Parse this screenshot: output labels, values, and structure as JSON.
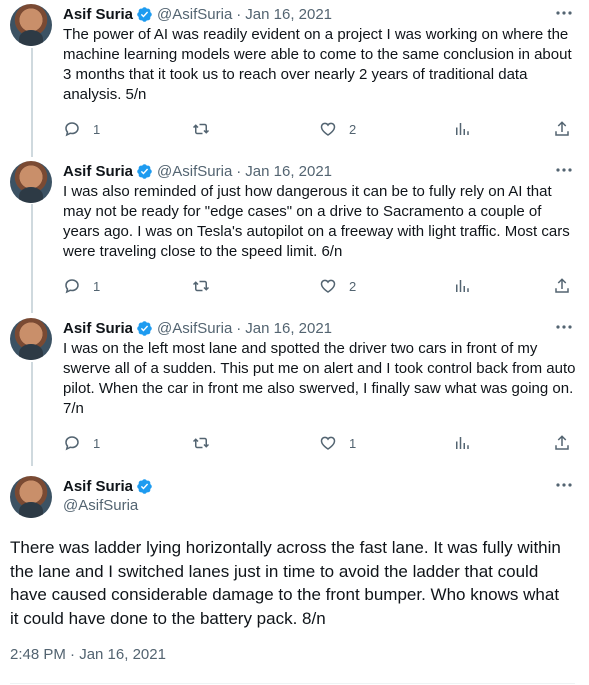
{
  "tweets": [
    {
      "name": "Asif Suria",
      "handle": "@AsifSuria",
      "separator": "·",
      "date": "Jan 16, 2021",
      "text": "The power of AI was readily evident on a project I was working on where the machine learning models were able to come to the same conclusion in about 3 months that it took us to reach over nearly 2 years of traditional data analysis. 5/n",
      "replies": "1",
      "retweets": "",
      "likes": "2"
    },
    {
      "name": "Asif Suria",
      "handle": "@AsifSuria",
      "separator": "·",
      "date": "Jan 16, 2021",
      "text": "I was also reminded of just how dangerous it can be to fully rely on AI that may not be ready for \"edge cases\" on a drive to Sacramento a couple of years ago. I was on Tesla's autopilot on a freeway with light traffic. Most cars were traveling close to the speed limit. 6/n",
      "replies": "1",
      "retweets": "",
      "likes": "2"
    },
    {
      "name": "Asif Suria",
      "handle": "@AsifSuria",
      "separator": "·",
      "date": "Jan 16, 2021",
      "text": "I was on the left most lane and spotted the driver two cars in front of my swerve all of a sudden. This put me on alert and I took control back from auto pilot. When the car in front me also swerved, I finally saw what was going on. 7/n",
      "replies": "1",
      "retweets": "",
      "likes": "1"
    }
  ],
  "main_tweet": {
    "name": "Asif Suria",
    "handle": "@AsifSuria",
    "text": "There was ladder lying horizontally across the fast lane. It was fully within the lane and I switched lanes just in time to avoid the ladder that could have caused considerable damage to the front bumper. Who knows what it could have done to the battery pack. 8/n",
    "timestamp": "2:48 PM · Jan 16, 2021"
  },
  "colors": {
    "verified": "#1d9bf0",
    "secondary_text": "#536471",
    "thread_line": "#cfd9de"
  }
}
